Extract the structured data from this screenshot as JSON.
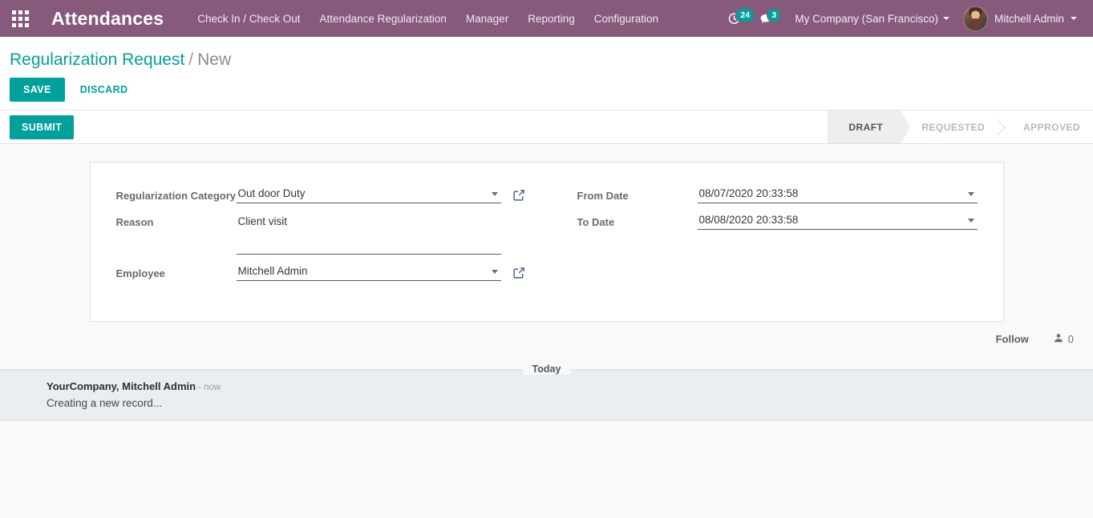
{
  "navbar": {
    "apps_icon": "apps-grid-icon",
    "brand": "Attendances",
    "menu": [
      {
        "label": "Check In / Check Out"
      },
      {
        "label": "Attendance Regularization"
      },
      {
        "label": "Manager"
      },
      {
        "label": "Reporting"
      },
      {
        "label": "Configuration"
      }
    ],
    "activity": {
      "icon": "clock-activity-icon",
      "count": "24"
    },
    "messages": {
      "icon": "chat-bubble-icon",
      "count": "3"
    },
    "company": "My Company (San Francisco)",
    "user": "Mitchell Admin"
  },
  "breadcrumb": {
    "root": "Regularization Request",
    "separator": "/",
    "current": "New"
  },
  "control_panel": {
    "save_label": "SAVE",
    "discard_label": "DISCARD"
  },
  "statusbar": {
    "submit_label": "SUBMIT",
    "stages": [
      {
        "label": "DRAFT",
        "active": true
      },
      {
        "label": "REQUESTED",
        "active": false
      },
      {
        "label": "APPROVED",
        "active": false
      }
    ]
  },
  "form": {
    "left": {
      "category_label": "Regularization Category",
      "category_value": "Out door Duty",
      "category_placeholder": "",
      "reason_label": "Reason",
      "reason_value": "Client visit",
      "reason_placeholder": "",
      "employee_label": "Employee",
      "employee_value": "Mitchell Admin",
      "employee_placeholder": ""
    },
    "right": {
      "from_date_label": "From Date",
      "from_date_value": "08/07/2020 20:33:58",
      "to_date_label": "To Date",
      "to_date_value": "08/08/2020 20:33:58"
    },
    "internal_link_icon": "external-link-icon"
  },
  "chatter": {
    "follow_label": "Follow",
    "followers_icon": "user-followers-icon",
    "followers_count": "0",
    "day_separator": "Today",
    "message": {
      "author": "YourCompany, Mitchell Admin",
      "time": "- now",
      "body": "Creating a new record..."
    }
  },
  "colors": {
    "brand_purple": "#875A7B",
    "accent_teal": "#00A09D",
    "page_bg": "#F9F9F9",
    "message_bg": "#E9EEF0",
    "stage_active_bg": "#EEEEEE"
  }
}
